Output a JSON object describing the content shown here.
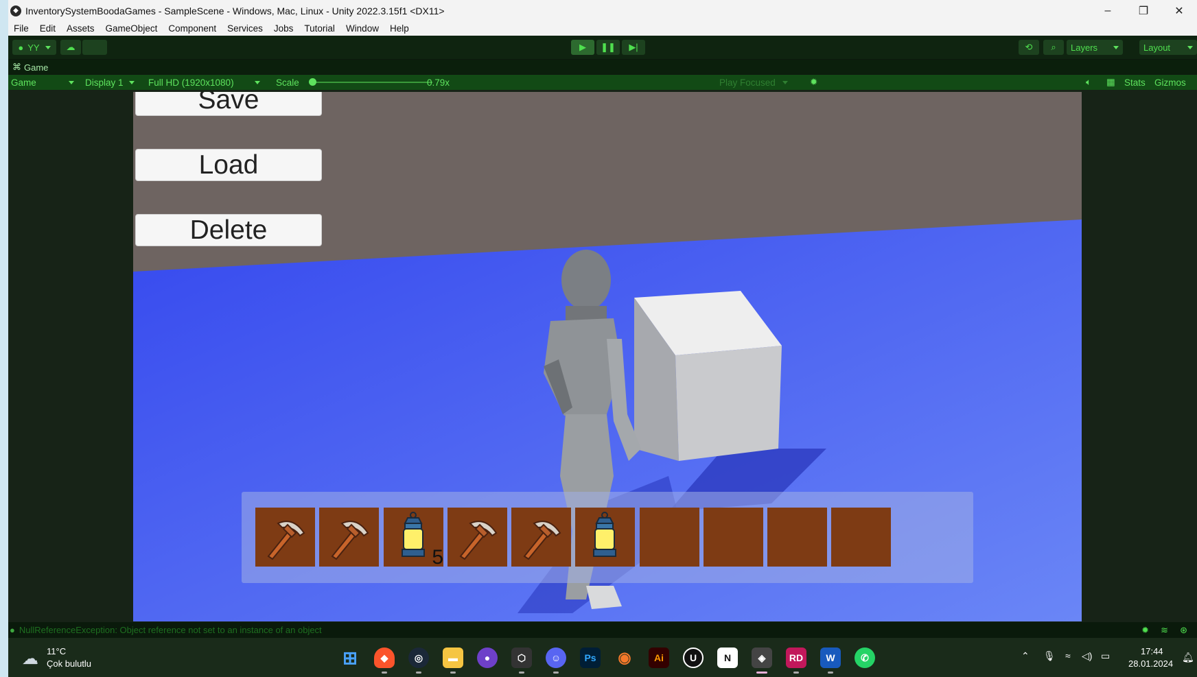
{
  "window": {
    "title": "InventorySystemBoodaGames - SampleScene - Windows, Mac, Linux - Unity 2022.3.15f1 <DX11>",
    "controls": [
      "–",
      "❐",
      "✕"
    ]
  },
  "menu": [
    "File",
    "Edit",
    "Assets",
    "GameObject",
    "Component",
    "Services",
    "Jobs",
    "Tutorial",
    "Window",
    "Help"
  ],
  "toolbar": {
    "account": "YY",
    "layers_label": "Layers",
    "layout_label": "Layout"
  },
  "game_tab": {
    "label": "Game"
  },
  "game_controls": {
    "view": "Game",
    "display": "Display 1",
    "resolution": "Full HD (1920x1080)",
    "scale_label": "Scale",
    "scale_value": "0.79x",
    "play_mode": "Play Focused",
    "stats": "Stats",
    "gizmos": "Gizmos"
  },
  "scene": {
    "buttons": {
      "save": "Save",
      "load": "Load",
      "delete": "Delete"
    },
    "colors": {
      "floor": "#3b52f2",
      "wall": "#6e6461",
      "slot": "#7e3b14"
    },
    "hotbar": [
      {
        "item": "pickaxe-icon",
        "count": ""
      },
      {
        "item": "pickaxe-icon",
        "count": ""
      },
      {
        "item": "lantern-icon",
        "count": "5"
      },
      {
        "item": "pickaxe-icon",
        "count": ""
      },
      {
        "item": "pickaxe-icon",
        "count": ""
      },
      {
        "item": "lantern-icon",
        "count": ""
      },
      {
        "item": "",
        "count": ""
      },
      {
        "item": "",
        "count": ""
      },
      {
        "item": "",
        "count": ""
      },
      {
        "item": "",
        "count": ""
      }
    ]
  },
  "status": {
    "message": "NullReferenceException: Object reference not set to an instance of an object"
  },
  "taskbar": {
    "weather_temp": "11°C",
    "weather_desc": "Çok bulutlu",
    "time": "17:44",
    "date": "28.01.2024"
  }
}
